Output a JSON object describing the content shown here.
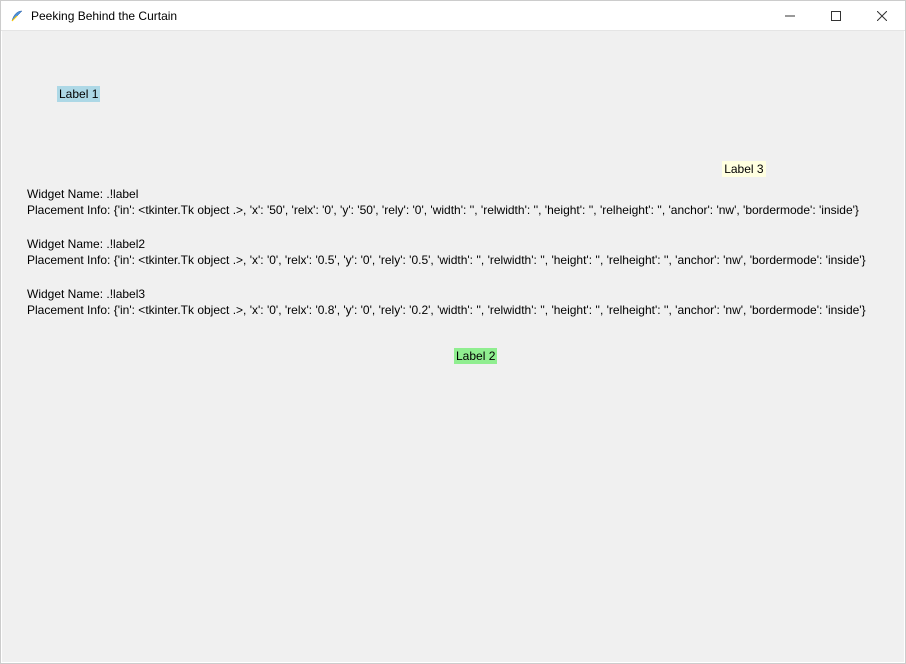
{
  "window": {
    "title": "Peeking Behind the Curtain"
  },
  "labels": {
    "label1": "Label 1",
    "label2": "Label 2",
    "label3": "Label 3"
  },
  "info": {
    "block1": {
      "name_line": "Widget Name: .!label",
      "placement_line": "Placement Info: {'in': <tkinter.Tk object .>, 'x': '50', 'relx': '0', 'y': '50', 'rely': '0', 'width': '', 'relwidth': '', 'height': '', 'relheight': '', 'anchor': 'nw', 'bordermode': 'inside'}"
    },
    "block2": {
      "name_line": "Widget Name: .!label2",
      "placement_line": "Placement Info: {'in': <tkinter.Tk object .>, 'x': '0', 'relx': '0.5', 'y': '0', 'rely': '0.5', 'width': '', 'relwidth': '', 'height': '', 'relheight': '', 'anchor': 'nw', 'bordermode': 'inside'}"
    },
    "block3": {
      "name_line": "Widget Name: .!label3",
      "placement_line": "Placement Info: {'in': <tkinter.Tk object .>, 'x': '0', 'relx': '0.8', 'y': '0', 'rely': '0.2', 'width': '', 'relwidth': '', 'height': '', 'relheight': '', 'anchor': 'nw', 'bordermode': 'inside'}"
    }
  },
  "layout": {
    "client_width": 894,
    "client_height": 623,
    "label2_relx": 0.5,
    "label2_rely": 0.5,
    "label3_relx": 0.8,
    "label3_rely": 0.2
  },
  "colors": {
    "label1_bg": "#add8e6",
    "label2_bg": "#90ee90",
    "label3_bg": "#ffffe0",
    "window_bg": "#f0f0f0"
  }
}
